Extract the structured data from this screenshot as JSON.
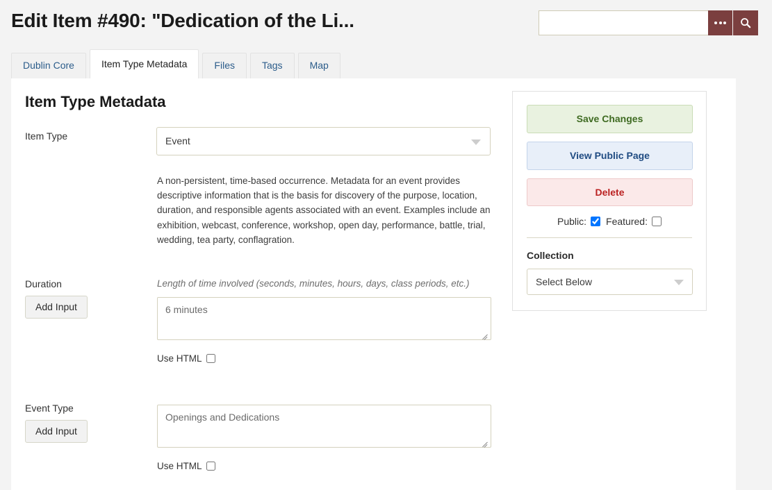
{
  "header": {
    "title": "Edit Item #490: \"Dedication of the Li...",
    "search": {
      "value": "",
      "placeholder": "",
      "advanced_icon": "ellipsis-icon",
      "submit_icon": "search-icon"
    }
  },
  "tabs": [
    {
      "label": "Dublin Core",
      "active": false
    },
    {
      "label": "Item Type Metadata",
      "active": true
    },
    {
      "label": "Files",
      "active": false
    },
    {
      "label": "Tags",
      "active": false
    },
    {
      "label": "Map",
      "active": false
    }
  ],
  "main": {
    "section_title": "Item Type Metadata",
    "item_type": {
      "label": "Item Type",
      "value": "Event",
      "description": "A non-persistent, time-based occurrence. Metadata for an event provides descriptive information that is the basis for discovery of the purpose, location, duration, and responsible agents associated with an event. Examples include an exhibition, webcast, conference, workshop, open day, performance, battle, trial, wedding, tea party, conflagration."
    },
    "fields": [
      {
        "label": "Duration",
        "add_input_label": "Add Input",
        "help_text": "Length of time involved (seconds, minutes, hours, days, class periods, etc.)",
        "value": "6 minutes",
        "use_html_label": "Use HTML",
        "use_html_checked": false
      },
      {
        "label": "Event Type",
        "add_input_label": "Add Input",
        "help_text": "",
        "value": "Openings and Dedications",
        "use_html_label": "Use HTML",
        "use_html_checked": false
      }
    ]
  },
  "sidebar": {
    "save_label": "Save Changes",
    "view_label": "View Public Page",
    "delete_label": "Delete",
    "public_label": "Public:",
    "public_checked": true,
    "featured_label": "Featured:",
    "featured_checked": false,
    "collection_label": "Collection",
    "collection_value": "Select Below"
  },
  "colors": {
    "page_bg": "#f3f3f3",
    "panel_bg": "#ffffff",
    "accent_maroon": "#7b3f3f",
    "tab_link": "#2b5c8a",
    "save_green": "#3f6b22",
    "view_blue": "#1f4b82",
    "delete_red": "#bb2222",
    "input_border": "#d4d1bd"
  }
}
